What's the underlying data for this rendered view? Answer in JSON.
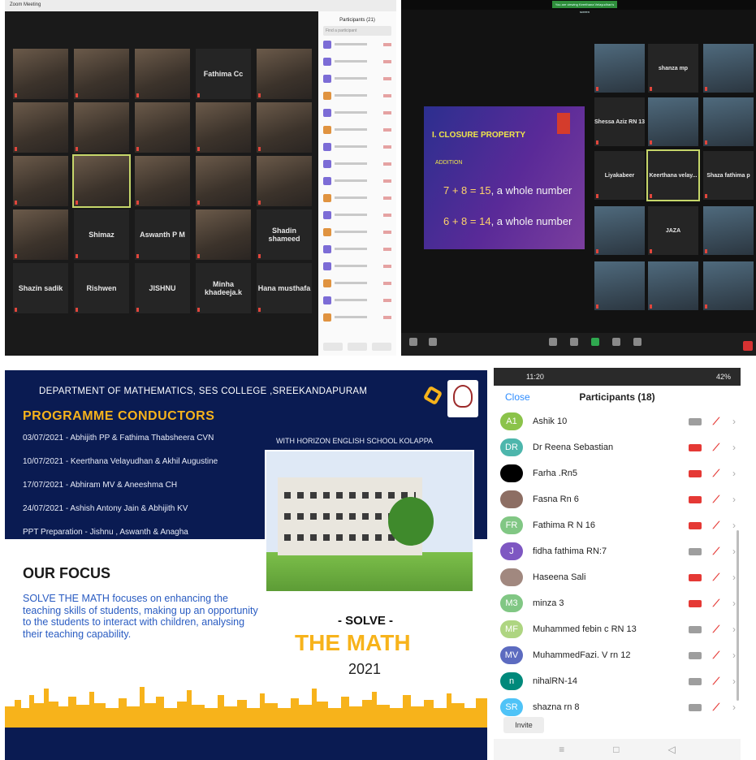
{
  "panel1": {
    "window_title": "Zoom Meeting",
    "participants_title": "Participants (21)",
    "search_placeholder": "Find a participant",
    "tiles": [
      {
        "label": "",
        "photo": true
      },
      {
        "label": "",
        "photo": true
      },
      {
        "label": "",
        "photo": true
      },
      {
        "label": "Fathima Cc",
        "photo": false
      },
      {
        "label": "",
        "photo": true
      },
      {
        "label": "",
        "photo": true
      },
      {
        "label": "",
        "photo": true
      },
      {
        "label": "",
        "photo": true
      },
      {
        "label": "",
        "photo": true
      },
      {
        "label": "",
        "photo": true
      },
      {
        "label": "",
        "photo": true
      },
      {
        "label": "",
        "photo": true,
        "active": true
      },
      {
        "label": "",
        "photo": true
      },
      {
        "label": "",
        "photo": true
      },
      {
        "label": "",
        "photo": true
      },
      {
        "label": "",
        "photo": true
      },
      {
        "label": "Shimaz",
        "photo": false
      },
      {
        "label": "Aswanth P M",
        "photo": false
      },
      {
        "label": "",
        "photo": true
      },
      {
        "label": "Shadin shameed",
        "photo": false
      },
      {
        "label": "Shazin sadik",
        "photo": false
      },
      {
        "label": "Rishwen",
        "photo": false
      },
      {
        "label": "JISHNU",
        "photo": false
      },
      {
        "label": "Minha khadeeja.k",
        "photo": false
      },
      {
        "label": "Hana musthafa",
        "photo": false
      }
    ]
  },
  "panel2": {
    "banner": "You are viewing Keerthana Velayudhan's screen",
    "slide": {
      "heading": "I. CLOSURE PROPERTY",
      "sub": "ADDITION",
      "eq1": {
        "expr": "7 + 8 = 15",
        "text": ", a whole number"
      },
      "eq2": {
        "expr": "6 + 8 = 14",
        "text": ", a whole number"
      }
    },
    "tiles": [
      {
        "label": "",
        "photo": true
      },
      {
        "label": "shanza mp",
        "photo": false
      },
      {
        "label": "",
        "photo": true
      },
      {
        "label": "Shessa Aziz RN 13",
        "photo": false
      },
      {
        "label": "",
        "photo": true
      },
      {
        "label": "",
        "photo": true
      },
      {
        "label": "Liyakabeer",
        "photo": false
      },
      {
        "label": "Keerthana velay...",
        "photo": false,
        "active": true
      },
      {
        "label": "Shaza fathima p",
        "photo": false
      },
      {
        "label": "",
        "photo": true
      },
      {
        "label": "JAZA",
        "photo": false
      },
      {
        "label": "",
        "photo": true
      },
      {
        "label": "",
        "photo": true
      },
      {
        "label": "",
        "photo": true
      },
      {
        "label": "",
        "photo": true
      }
    ]
  },
  "poster": {
    "header": "DEPARTMENT OF MATHEMATICS, SES COLLEGE ,SREEKANDAPURAM",
    "programme_title": "PROGRAMME CONDUCTORS",
    "schedule": [
      "03/07/2021 - Abhijith PP & Fathima Thabsheera CVN",
      "10/07/2021 - Keerthana Velayudhan & Akhil Augustine",
      "17/07/2021 - Abhiram MV & Aneeshma CH",
      "24/07/2021 - Ashish Antony Jain & Abhijith KV",
      "PPT Preparation - Jishnu , Aswanth & Anagha"
    ],
    "with": "WITH HORIZON ENGLISH SCHOOL KOLAPPA",
    "focus_title": "OUR FOCUS",
    "focus_text": "SOLVE THE MATH focuses on enhancing the teaching skills of students, making up an opportunity to the students to interact with children, analysing their teaching capability.",
    "solve": "- SOLVE -",
    "the_math": "THE MATH",
    "year": "2021"
  },
  "mobile": {
    "time": "11:20",
    "battery": "42%",
    "close": "Close",
    "title": "Participants (18)",
    "participants": [
      {
        "initials": "A1",
        "name": "Ashik 10",
        "color": "#8bc34a",
        "cam_off": false,
        "muted": true
      },
      {
        "initials": "DR",
        "name": "Dr Reena Sebastian",
        "color": "#4db6ac",
        "cam_off": true,
        "muted": true
      },
      {
        "initials": "",
        "name": "Farha .Rn5",
        "color": "#000000",
        "cam_off": true,
        "muted": true
      },
      {
        "initials": "",
        "name": "Fasna Rn 6",
        "color": "#8d6e63",
        "cam_off": true,
        "muted": true
      },
      {
        "initials": "FR",
        "name": "Fathima R N 16",
        "color": "#81c784",
        "cam_off": true,
        "muted": true
      },
      {
        "initials": "J",
        "name": "fidha fathima RN:7",
        "color": "#7e57c2",
        "cam_off": false,
        "muted": true
      },
      {
        "initials": "",
        "name": "Haseena Sali",
        "color": "#a1887f",
        "cam_off": true,
        "muted": true
      },
      {
        "initials": "M3",
        "name": "minza 3",
        "color": "#81c784",
        "cam_off": true,
        "muted": true
      },
      {
        "initials": "MF",
        "name": "Muhammed febin c RN 13",
        "color": "#aed581",
        "cam_off": false,
        "muted": true
      },
      {
        "initials": "MV",
        "name": "MuhammedFazi. V rn 12",
        "color": "#5c6bc0",
        "cam_off": false,
        "muted": true
      },
      {
        "initials": "n",
        "name": "nihalRN-14",
        "color": "#00897b",
        "cam_off": false,
        "muted": true
      },
      {
        "initials": "SR",
        "name": "shazna rn 8",
        "color": "#4fc3f7",
        "cam_off": false,
        "muted": true
      }
    ],
    "invite": "Invite"
  }
}
